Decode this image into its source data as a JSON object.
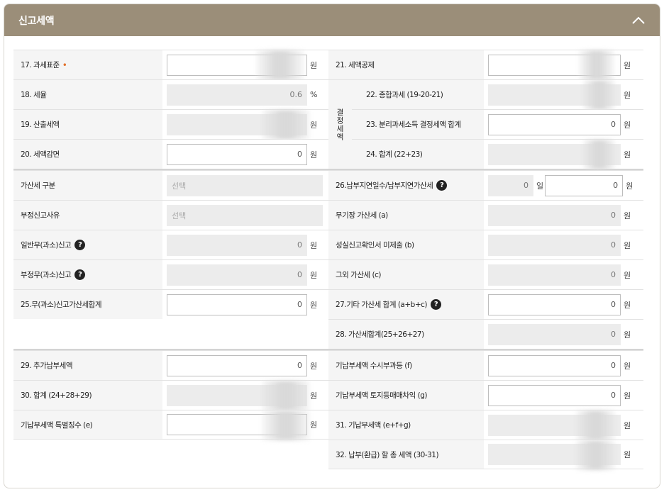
{
  "header": {
    "title": "신고세액"
  },
  "units": {
    "won": "원",
    "percent": "%",
    "day": "일"
  },
  "group_label": "결정세액",
  "left_rows": [
    {
      "label": "17. 과세표준",
      "required_mark": "•"
    },
    {
      "label": "18. 세율",
      "value": "0.6"
    },
    {
      "label": "19. 산출세액"
    },
    {
      "label": "20. 세액감면",
      "value": "0"
    },
    {
      "label": "가산세 구분",
      "placeholder": "선택"
    },
    {
      "label": "부정신고사유",
      "placeholder": "선택"
    },
    {
      "label": "일반무(과소)신고",
      "value": "0"
    },
    {
      "label": "부정무(과소)신고",
      "value": "0"
    },
    {
      "label": "25.무(과소)신고가산세합계",
      "value": "0"
    },
    {
      "label": "29. 추가납부세액",
      "value": "0"
    },
    {
      "label": "30. 합계 (24+28+29)"
    },
    {
      "label": "기납부세액 특별징수 (e)"
    }
  ],
  "right_rows": [
    {
      "label": "21. 세액공제"
    },
    {
      "label": "22. 종합과세 (19-20-21)"
    },
    {
      "label": "23. 분리과세소득 결정세액 합계",
      "value": "0"
    },
    {
      "label": "24. 합계 (22+23)"
    },
    {
      "label": "26.납부지연일수/납부지연가산세",
      "days": "0",
      "value": "0"
    },
    {
      "label": "무기장 가산세 (a)",
      "value": "0"
    },
    {
      "label": "성실신고확인서 미제출 (b)",
      "value": "0"
    },
    {
      "label": "그외 가산세 (c)",
      "value": "0"
    },
    {
      "label": "27.기타 가산세 합계 (a+b+c)",
      "value": "0"
    },
    {
      "label": "28. 가산세합계(25+26+27)",
      "value": "0"
    },
    {
      "label": "기납부세액 수시부과등 (f)",
      "value": "0"
    },
    {
      "label": "기납부세액 토지등매매차익 (g)",
      "value": "0"
    },
    {
      "label": "31. 기납부세액 (e+f+g)"
    },
    {
      "label": "32. 납부(환급) 할 총 세액 (30-31)"
    }
  ],
  "help_icon_text": "?"
}
